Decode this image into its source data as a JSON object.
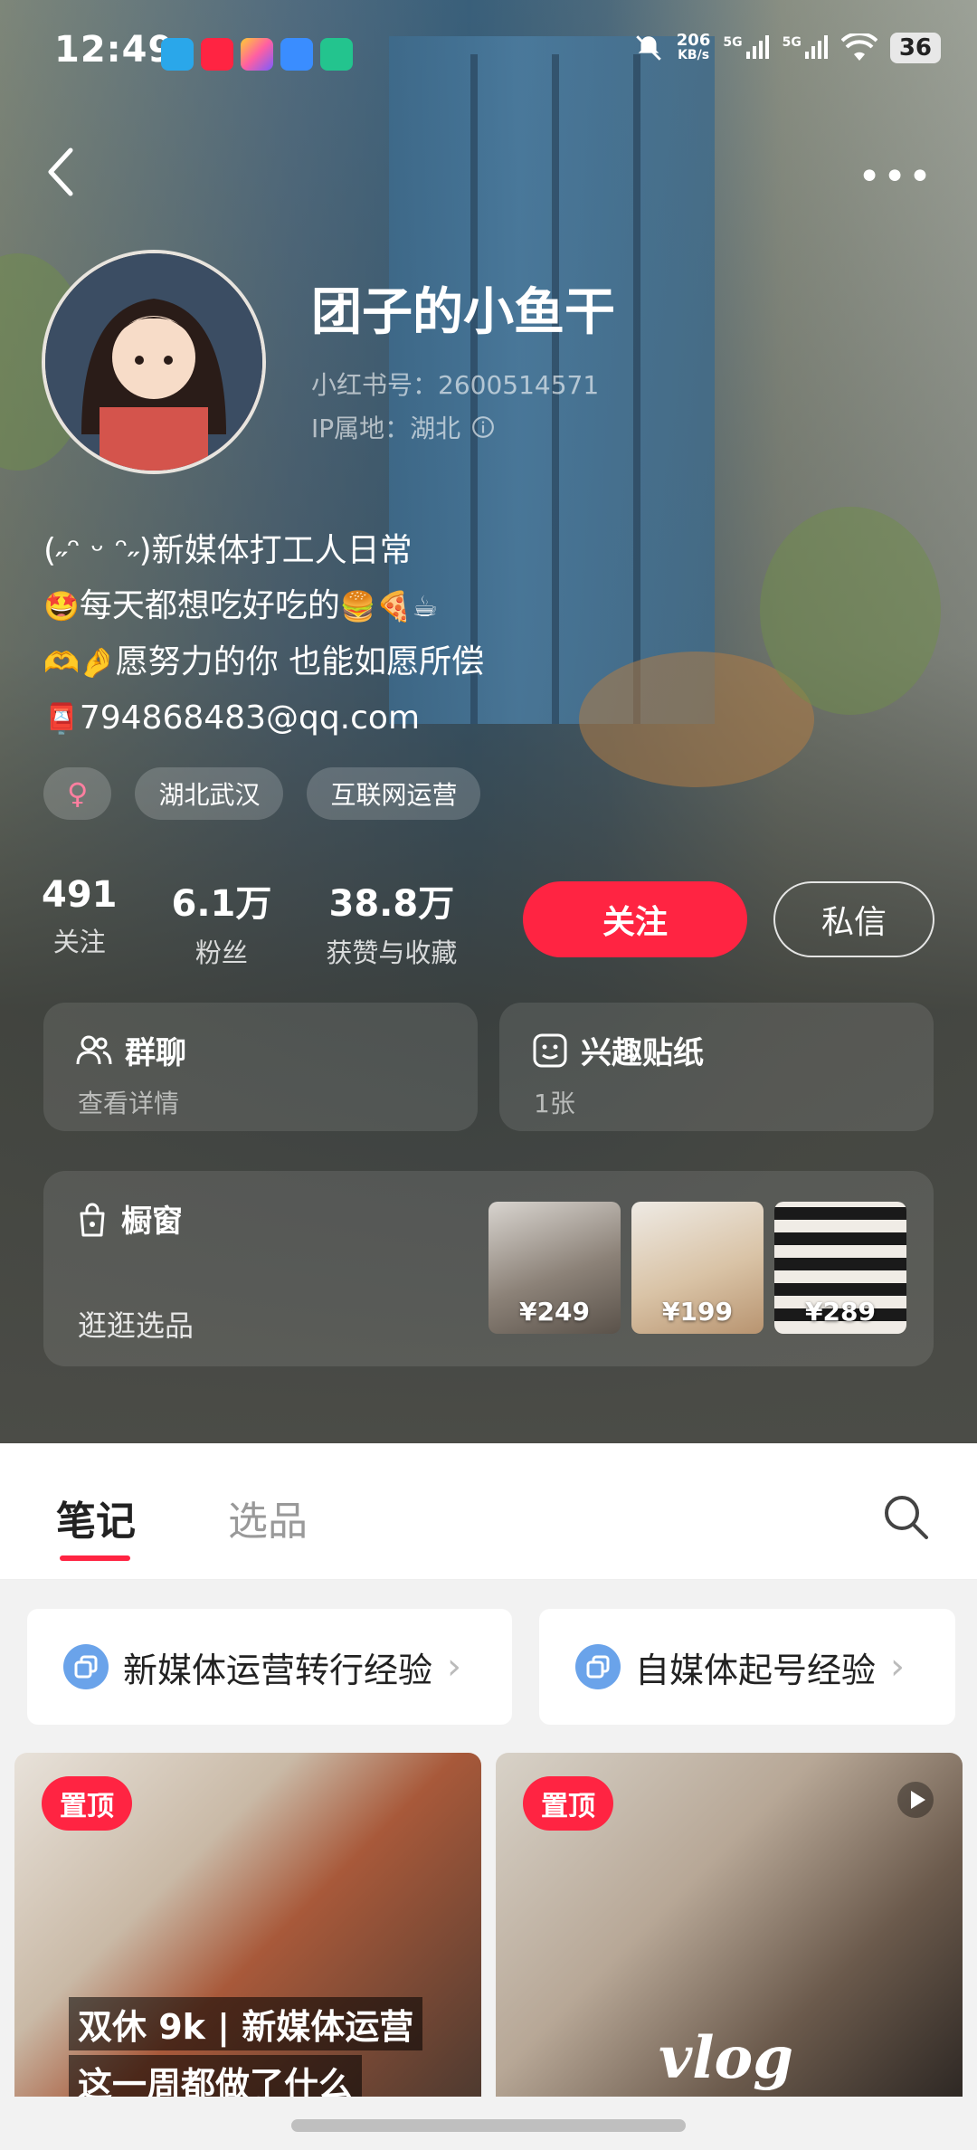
{
  "status_bar": {
    "time": "12:49",
    "speed": "206",
    "speed_unit": "KB/s",
    "net1": "5G",
    "net2": "5G",
    "battery": "36"
  },
  "profile": {
    "name": "团子的小鱼干",
    "red_id": "小红书号：2600514571",
    "ip_location": "IP属地：湖北",
    "bio": [
      "(˶ᵔ ᵕ ᵔ˶)新媒体打工人日常",
      "每天都想吃好吃的",
      "愿努力的你 也能如愿所偿",
      "794868483@qq.com"
    ],
    "bio_emoji": [
      "🤩",
      "🍔🍕☕",
      "🫶🤌",
      "📮"
    ],
    "tags": {
      "gender": "♀",
      "location": "湖北武汉",
      "industry": "互联网运营"
    },
    "stats": [
      {
        "value": "491",
        "label": "关注"
      },
      {
        "value": "6.1万",
        "label": "粉丝"
      },
      {
        "value": "38.8万",
        "label": "获赞与收藏"
      }
    ],
    "follow_button": "关注",
    "message_button": "私信"
  },
  "cards": {
    "group_chat": {
      "title": "群聊",
      "subtitle": "查看详情"
    },
    "stickers": {
      "title": "兴趣贴纸",
      "subtitle": "1张"
    },
    "shop": {
      "title": "橱窗",
      "subtitle": "逛逛选品",
      "products": [
        {
          "price": "¥249"
        },
        {
          "price": "¥199"
        },
        {
          "price": "¥289"
        }
      ]
    }
  },
  "tabs": {
    "notes": "笔记",
    "selection": "选品"
  },
  "collections": [
    {
      "label": "新媒体运营转行经验"
    },
    {
      "label": "自媒体起号经验"
    }
  ],
  "posts": [
    {
      "badge": "置顶",
      "title_line1": "双休 9k | 新媒体运营",
      "title_line2": "这一周都做了什么"
    },
    {
      "badge": "置顶",
      "overlay_text": "vlog"
    }
  ],
  "colors": {
    "accent": "#ff2442",
    "collection_icon": "#6aa3ea"
  }
}
